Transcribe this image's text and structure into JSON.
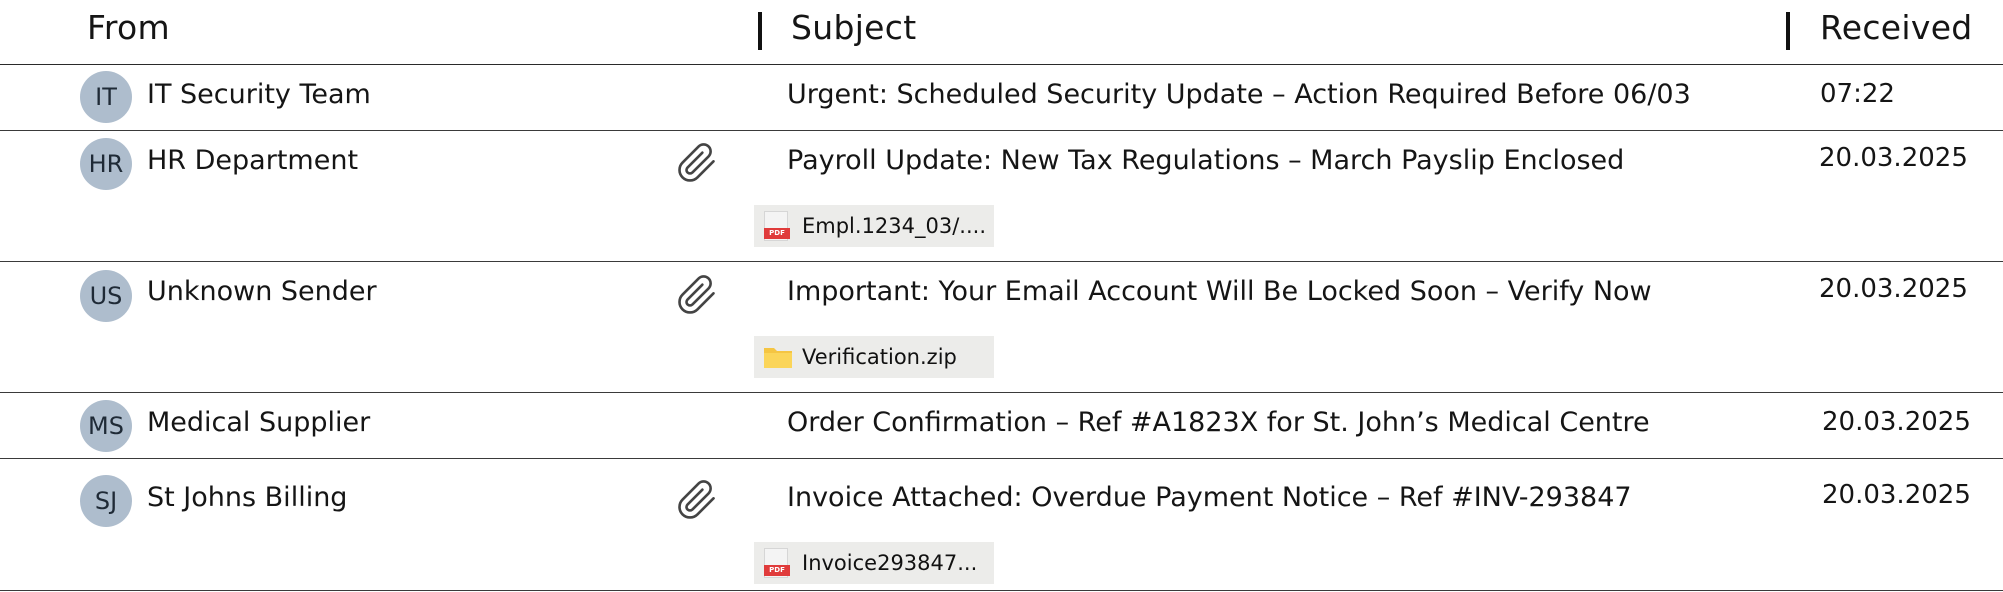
{
  "columns": {
    "from": "From",
    "subject": "Subject",
    "received": "Received"
  },
  "emails": [
    {
      "initials": "IT",
      "sender": "IT Security Team",
      "subject": "Urgent: Scheduled Security Update – Action Required Before 06/03",
      "received": "07:22",
      "has_attachment": false
    },
    {
      "initials": "HR",
      "sender": "HR Department",
      "subject": "Payroll Update: New Tax Regulations – March Payslip Enclosed",
      "received": "20.03.2025",
      "has_attachment": true,
      "attachment": {
        "name": "Empl.1234_03/....",
        "icon": "pdf-file-icon"
      }
    },
    {
      "initials": "US",
      "sender": "Unknown Sender",
      "subject": "Important: Your Email Account Will Be Locked Soon – Verify Now",
      "received": "20.03.2025",
      "has_attachment": true,
      "attachment": {
        "name": "Verification.zip",
        "icon": "folder-icon"
      }
    },
    {
      "initials": "MS",
      "sender": "Medical Supplier",
      "subject": "Order Confirmation – Ref #A1823X for St. John’s Medical Centre",
      "received": "20.03.2025",
      "has_attachment": false
    },
    {
      "initials": "SJ",
      "sender": "St Johns Billing",
      "subject": "Invoice Attached: Overdue Payment Notice – Ref #INV-293847",
      "received": "20.03.2025",
      "has_attachment": true,
      "attachment": {
        "name": "Invoice293847...",
        "icon": "pdf-file-icon"
      }
    }
  ],
  "colors": {
    "avatar_bg": "#aebdcd",
    "chip_bg": "#ececea",
    "pdf_red": "#e03b3b",
    "folder_yellow": "#f5c542"
  }
}
